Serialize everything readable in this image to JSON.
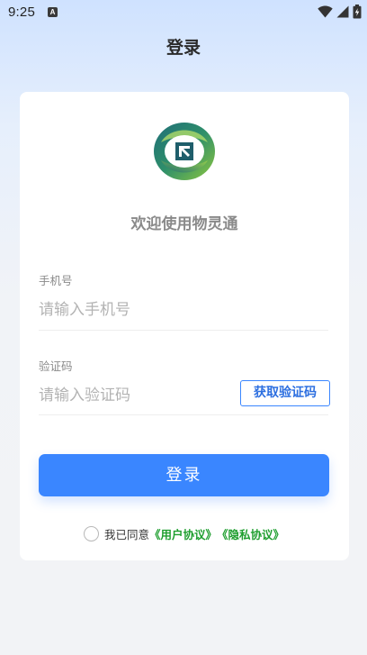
{
  "status_bar": {
    "time": "9:25",
    "notification_glyph": "A",
    "icons": [
      "wifi-icon",
      "signal-icon",
      "battery-icon"
    ]
  },
  "header": {
    "title": "登录"
  },
  "card": {
    "logo": "app-logo",
    "welcome": "欢迎使用物灵通",
    "phone": {
      "label": "手机号",
      "placeholder": "请输入手机号",
      "value": ""
    },
    "code": {
      "label": "验证码",
      "placeholder": "请输入验证码",
      "value": "",
      "get_code_label": "获取验证码"
    },
    "login_button": "登录",
    "agreement": {
      "prefix": "我已同意",
      "user_agreement": "《用户协议》",
      "privacy_agreement": "《隐私协议》",
      "checked": false
    }
  },
  "colors": {
    "primary": "#3a86ff",
    "link_green": "#1e9e2e",
    "logo_dark": "#1f6e78",
    "logo_light": "#8dc63f"
  }
}
